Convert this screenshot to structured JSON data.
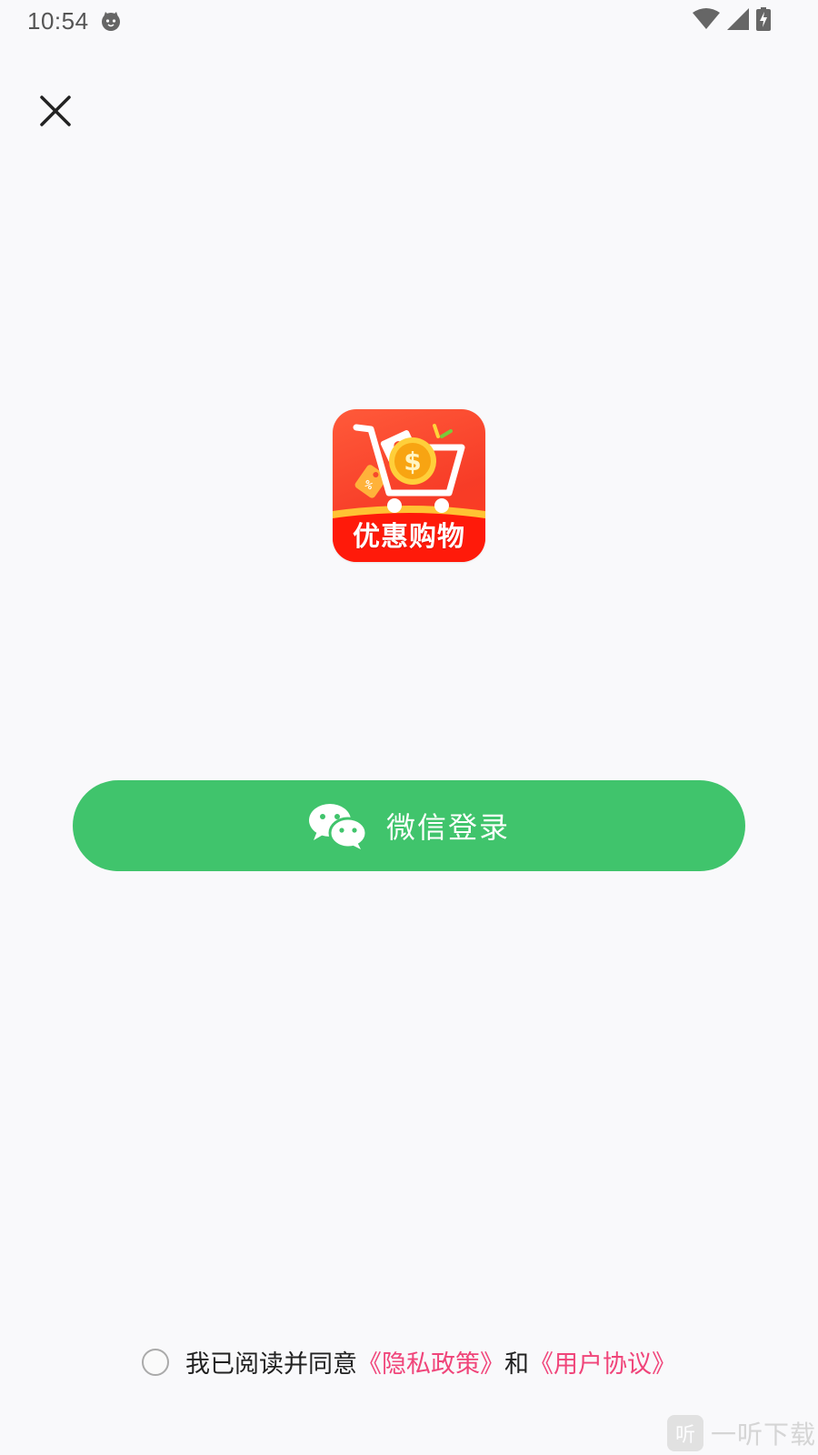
{
  "status_bar": {
    "time": "10:54",
    "icons": [
      "cat-notification-icon",
      "wifi-icon",
      "cell-signal-icon",
      "battery-charging-icon"
    ]
  },
  "header": {
    "close_icon": "close-icon"
  },
  "app": {
    "name": "优惠购物",
    "logo_icon": "shopping-cart-coin-icon",
    "colors": {
      "logo_background": "#f74a2c",
      "coin": "#fbb617"
    }
  },
  "login": {
    "wechat_label": "微信登录",
    "icon": "wechat-icon",
    "button_color": "#40c46c"
  },
  "agreement": {
    "checked": false,
    "prefix": "我已阅读并同意",
    "privacy_link": "《隐私政策》",
    "conjunction": "和",
    "terms_link": "《用户协议》",
    "link_color": "#f0457a"
  },
  "watermark": {
    "logo_char": "听",
    "text": "一听下载"
  }
}
